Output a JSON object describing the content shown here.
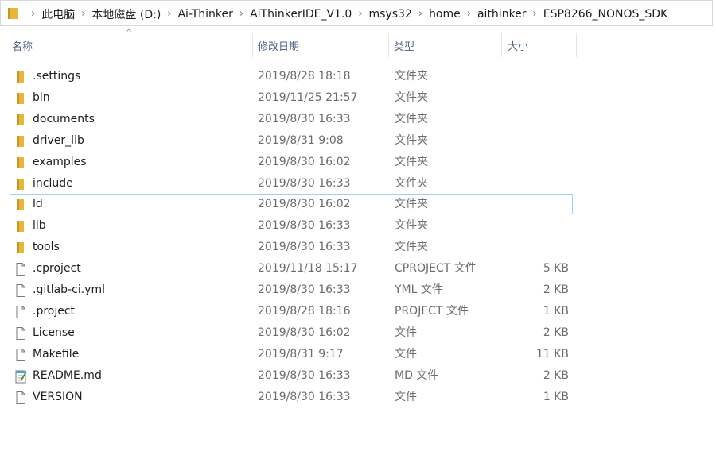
{
  "breadcrumbs": [
    "此电脑",
    "本地磁盘 (D:)",
    "Ai-Thinker",
    "AiThinkerIDE_V1.0",
    "msys32",
    "home",
    "aithinker",
    "ESP8266_NONOS_SDK"
  ],
  "columns": {
    "name": "名称",
    "date": "修改日期",
    "type": "类型",
    "size": "大小"
  },
  "colors": {
    "folder": "#e8b73a",
    "header_text": "#4d6082",
    "focus_border": "#99d1ff"
  },
  "files": [
    {
      "name": ".settings",
      "date": "2019/8/28 18:18",
      "type": "文件夹",
      "size": "",
      "icon": "folder-icon"
    },
    {
      "name": "bin",
      "date": "2019/11/25 21:57",
      "type": "文件夹",
      "size": "",
      "icon": "folder-icon"
    },
    {
      "name": "documents",
      "date": "2019/8/30 16:33",
      "type": "文件夹",
      "size": "",
      "icon": "folder-icon"
    },
    {
      "name": "driver_lib",
      "date": "2019/8/31 9:08",
      "type": "文件夹",
      "size": "",
      "icon": "folder-icon"
    },
    {
      "name": "examples",
      "date": "2019/8/30 16:02",
      "type": "文件夹",
      "size": "",
      "icon": "folder-icon"
    },
    {
      "name": "include",
      "date": "2019/8/30 16:33",
      "type": "文件夹",
      "size": "",
      "icon": "folder-icon"
    },
    {
      "name": "ld",
      "date": "2019/8/30 16:02",
      "type": "文件夹",
      "size": "",
      "icon": "folder-icon",
      "focused": true
    },
    {
      "name": "lib",
      "date": "2019/8/30 16:33",
      "type": "文件夹",
      "size": "",
      "icon": "folder-icon"
    },
    {
      "name": "tools",
      "date": "2019/8/30 16:33",
      "type": "文件夹",
      "size": "",
      "icon": "folder-icon"
    },
    {
      "name": ".cproject",
      "date": "2019/11/18 15:17",
      "type": "CPROJECT 文件",
      "size": "5 KB",
      "icon": "file-icon"
    },
    {
      "name": ".gitlab-ci.yml",
      "date": "2019/8/30 16:33",
      "type": "YML 文件",
      "size": "2 KB",
      "icon": "file-icon"
    },
    {
      "name": ".project",
      "date": "2019/8/28 18:16",
      "type": "PROJECT 文件",
      "size": "1 KB",
      "icon": "file-icon"
    },
    {
      "name": "License",
      "date": "2019/8/30 16:02",
      "type": "文件",
      "size": "2 KB",
      "icon": "file-icon"
    },
    {
      "name": "Makefile",
      "date": "2019/8/31 9:17",
      "type": "文件",
      "size": "11 KB",
      "icon": "file-icon"
    },
    {
      "name": "README.md",
      "date": "2019/8/30 16:33",
      "type": "MD 文件",
      "size": "2 KB",
      "icon": "notepad-file-icon"
    },
    {
      "name": "VERSION",
      "date": "2019/8/30 16:33",
      "type": "文件",
      "size": "1 KB",
      "icon": "file-icon"
    }
  ]
}
